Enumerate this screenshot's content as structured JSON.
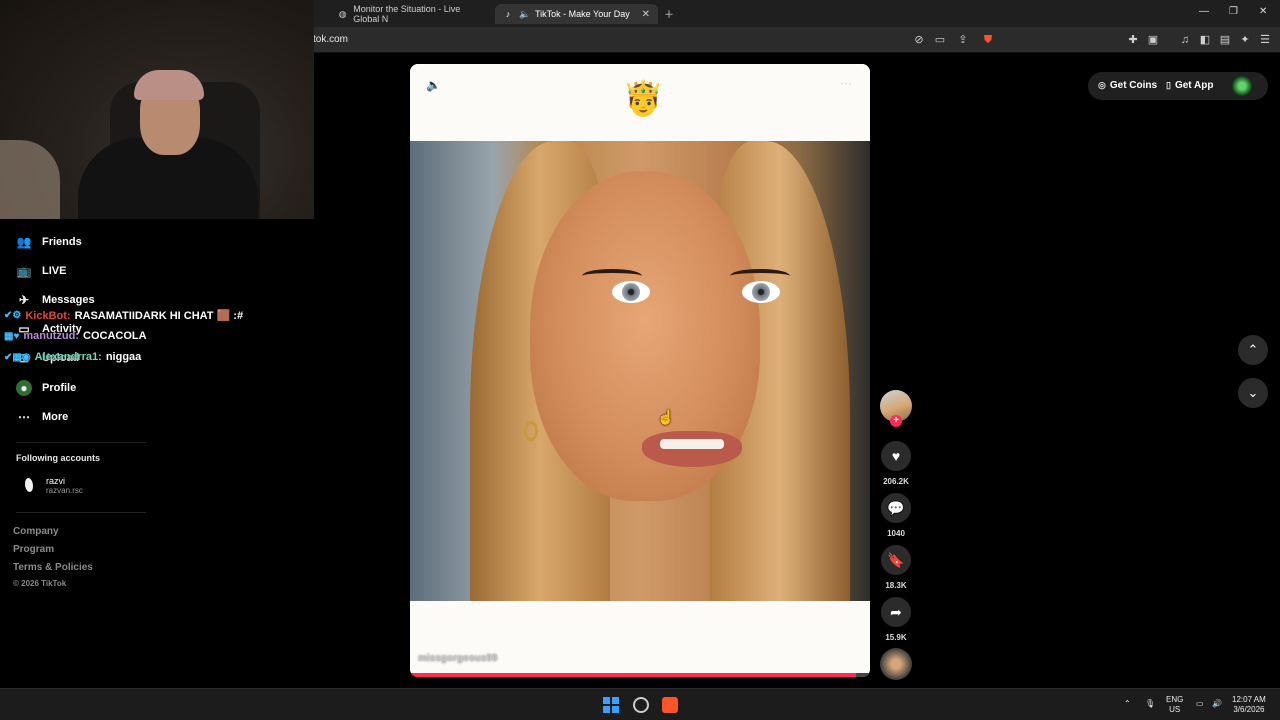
{
  "browser": {
    "tabs": [
      {
        "title": "Monitor the Situation - Live Global N"
      },
      {
        "title": "TikTok - Make Your Day",
        "active": true
      }
    ],
    "url": "tok.com"
  },
  "sidebar": {
    "items": [
      {
        "label": "Friends",
        "icon": "friends-icon"
      },
      {
        "label": "LIVE",
        "icon": "live-icon"
      },
      {
        "label": "Messages",
        "icon": "messages-icon"
      },
      {
        "label": "Activity",
        "icon": "activity-icon"
      },
      {
        "label": "Upload",
        "icon": "upload-icon"
      },
      {
        "label": "Profile",
        "icon": "profile-icon"
      },
      {
        "label": "More",
        "icon": "more-icon"
      }
    ],
    "following_title": "Following accounts",
    "following": [
      {
        "name": "razvi",
        "handle": "razvan.rsc"
      }
    ],
    "footer": [
      "Company",
      "Program",
      "Terms & Policies"
    ],
    "copyright": "© 2026 TikTok"
  },
  "chat": [
    {
      "user": "KickBot:",
      "user_color": "#e0473b",
      "message": "RASAMATIIDARK HI CHAT 🟫 :#"
    },
    {
      "user": "manutzud:",
      "user_color": "#b98ad9",
      "message": "COCACOLA"
    },
    {
      "user": "Alexandrra1:",
      "user_color": "#6fd6c0",
      "message": "niggaa"
    }
  ],
  "video": {
    "caption_emoji": "🤴",
    "username": "missgorgeous99",
    "progress": 0.97
  },
  "actions": {
    "likes": "206.2K",
    "comments": "1040",
    "saves": "18.3K",
    "shares": "15.9K"
  },
  "topbar": {
    "get_coins": "Get Coins",
    "get_app": "Get App"
  },
  "taskbar": {
    "lang": "ENG",
    "region": "US",
    "time": "12:07 AM",
    "date": "3/6/2026"
  },
  "colors": {
    "accent": "#fe2c55",
    "windows_blue": "#3aa0ff"
  }
}
